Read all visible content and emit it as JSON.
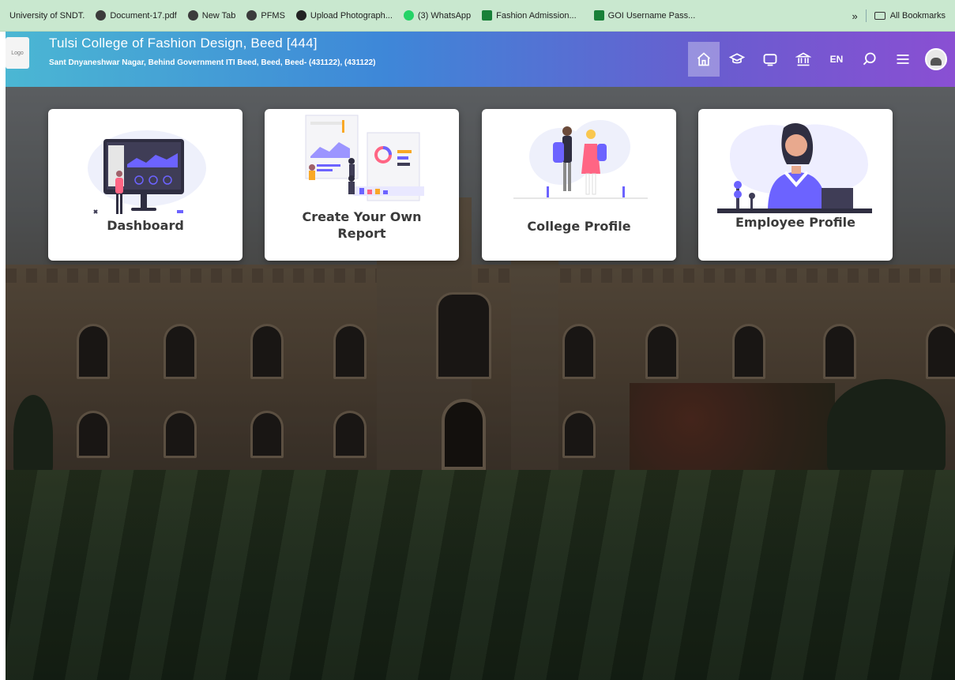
{
  "bookmarks": {
    "items": [
      {
        "label": "University of SNDT.",
        "icon": "none"
      },
      {
        "label": "Document-17.pdf",
        "icon": "globe-icon"
      },
      {
        "label": "New Tab",
        "icon": "globe-icon"
      },
      {
        "label": "PFMS",
        "icon": "globe-icon"
      },
      {
        "label": "Upload Photograph...",
        "icon": "upload-icon"
      },
      {
        "label": "(3) WhatsApp",
        "icon": "whatsapp-icon"
      },
      {
        "label": "Fashion Admission...",
        "icon": "sheets-icon"
      },
      {
        "label": "GOI Username Pass...",
        "icon": "sheets-icon"
      }
    ],
    "overflow": "»",
    "all_bookmarks": "All Bookmarks"
  },
  "header": {
    "logo_text": "Logo",
    "college_name": "Tulsi College of Fashion Design, Beed [444]",
    "address": "Sant Dnyaneshwar Nagar, Behind Government ITI Beed, Beed, Beed- (431122), (431122)",
    "language": "EN",
    "nav": [
      "home-icon",
      "graduation-cap-icon",
      "display-icon",
      "institution-icon",
      "language",
      "search-icon",
      "menu-icon",
      "avatar"
    ]
  },
  "cards": [
    {
      "title": "Dashboard"
    },
    {
      "title_line1": "Create Your Own",
      "title_line2": "Report"
    },
    {
      "title": "College Profile"
    },
    {
      "title": "Employee Profile"
    }
  ],
  "colors": {
    "bookmark_bar": "#c9e8cf",
    "header_start": "#4bb7d3",
    "header_end": "#8a4fd3",
    "accent_purple": "#6c63ff"
  }
}
